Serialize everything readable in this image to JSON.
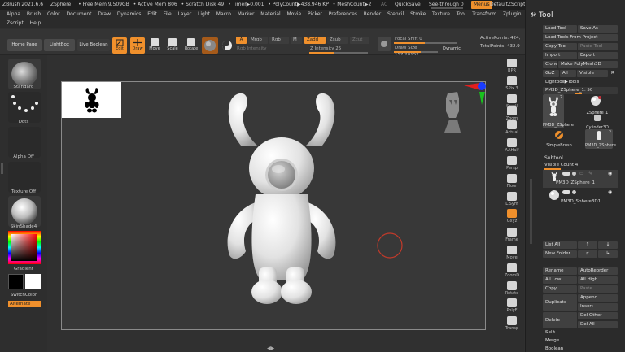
{
  "titlebar": {
    "app": "ZBrush 2021.6.6",
    "doc": "ZSphere",
    "free_mem": "• Free Mem 9.509GB",
    "active_mem": "• Active Mem 806",
    "scratch": "• Scratch Disk 49",
    "timer": "• Timer▶0.001",
    "polycount": "• PolyCount▶438.946 KP",
    "meshcount": "• MeshCount▶2",
    "ac": "AC",
    "quicksave": "QuickSave",
    "see_through": "See-through  0",
    "menus": "Menus",
    "script": "DefaultZScript"
  },
  "menubar": {
    "row1": [
      "Alpha",
      "Brush",
      "Color",
      "Document",
      "Draw",
      "Dynamics",
      "Edit",
      "File",
      "Layer",
      "Light",
      "Macro",
      "Marker",
      "Material",
      "Movie",
      "Picker",
      "Preferences",
      "Render",
      "Stencil",
      "Stroke",
      "Texture",
      "Tool",
      "Transform",
      "Zplugin"
    ],
    "row2": [
      "Zscript",
      "Help"
    ]
  },
  "shelf": {
    "home_page": "Home Page",
    "lightbox": "LightBox",
    "live_boolean": "Live Boolean",
    "edit": "Edit",
    "draw": "Draw",
    "move": "Move",
    "scale": "Scale",
    "rotate": "Rotate",
    "a": "A",
    "mrgb": "Mrgb",
    "rgb": "Rgb",
    "m": "M",
    "zadd": "Zadd",
    "zsub": "Zsub",
    "zcut": "Zcut",
    "rgb_intensity": "Rgb Intensity",
    "z_intensity": "Z Intensity 25",
    "focal_shift": "Focal Shift 0",
    "draw_size": "Draw Size 157.28152",
    "dynamic": "Dynamic",
    "active_points": "ActivePoints: 424,",
    "total_points": "TotalPoints: 432.9"
  },
  "left": {
    "brush": "Standard",
    "stroke": "Dots",
    "alpha": "Alpha Off",
    "texture": "Texture Off",
    "material": "SkinShade4",
    "gradient": "Gradient",
    "switch_color": "SwitchColor",
    "alternate": "Alternate"
  },
  "right_shelf": [
    "BPR",
    "SPix 3",
    "Scroll",
    "Zoom",
    "Actual",
    "AAHalf",
    "Persp",
    "Floor",
    "L.Sym",
    "Gxyz",
    "Frame",
    "Move",
    "ZoomD",
    "Rotate",
    "PolyF",
    "Transp"
  ],
  "palette": {
    "title": "Tool",
    "load_tool": "Load Tool",
    "save_as": "Save As",
    "load_from_project": "Load Tools From Project",
    "copy_tool": "Copy Tool",
    "paste_tool": "Paste Tool",
    "import": "Import",
    "export": "Export",
    "clone": "Clone",
    "make_polymesh": "Make PolyMesh3D",
    "goz": "GoZ",
    "all": "All",
    "visible": "Visible",
    "r": "R",
    "lightbox_tools": "Lightbox▶Tools",
    "current_tool": "PM3D_ZSphere_1. 50",
    "tools": [
      {
        "name": "PM3D_ZSphere",
        "badge": "2"
      },
      {
        "name": "ZSphere_1",
        "badge": ""
      },
      {
        "name": "Cylinder3D",
        "badge": ""
      },
      {
        "name": "SimpleBrush",
        "badge": ""
      },
      {
        "name": "PM3D_ZSphere",
        "badge": "2"
      }
    ],
    "subtool_title": "Subtool",
    "visible_count": "Visible Count 4",
    "subtools": [
      "PM3D_ZSphere_1",
      "PM3D_Sphere3D1"
    ],
    "list_all": "List All",
    "new_folder": "New Folder",
    "rename": "Rename",
    "auto_reorder": "AutoReorder",
    "all_low": "All Low",
    "all_high": "All High",
    "copy": "Copy",
    "paste": "Paste",
    "duplicate": "Duplicate",
    "append": "Append",
    "insert": "Insert",
    "delete": "Delete",
    "del_other": "Del Other",
    "del_all": "Del All",
    "split": "Split",
    "merge": "Merge",
    "boolean": "Boolean"
  },
  "colors": {
    "accent": "#f0902c",
    "canvas": "#383838",
    "panel": "#2b2b2b"
  }
}
